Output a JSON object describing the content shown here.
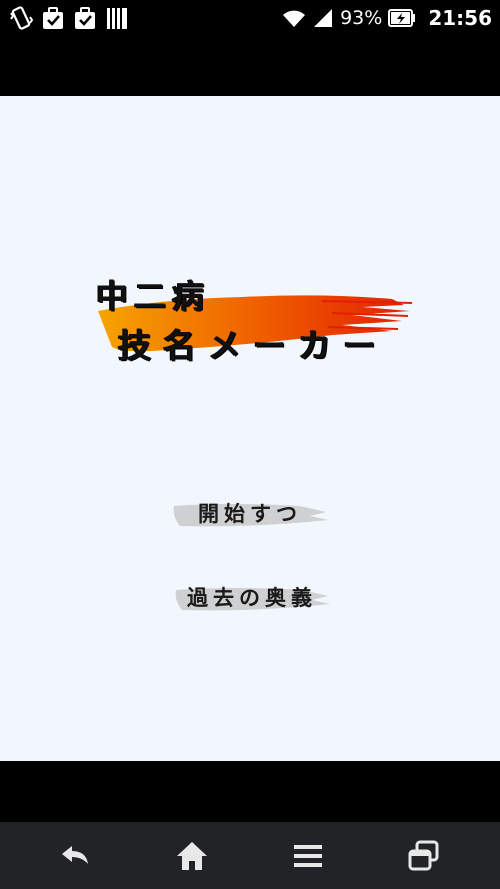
{
  "status_bar": {
    "battery_percent": "93%",
    "time": "21:56",
    "icons": [
      "vibrate-icon",
      "clipboard-check-icon",
      "briefcase-check-icon",
      "barcode-icon",
      "wifi-icon",
      "signal-icon",
      "battery-charging-icon"
    ]
  },
  "app": {
    "title_line1": "中二病",
    "title_line2": "技名メーカー",
    "brush_colors": [
      "#f7a400",
      "#e62a00"
    ]
  },
  "menu": {
    "start_label": "開始すつ",
    "past_label": "過去の奥義"
  },
  "nav_bar": {
    "icons": [
      "back-icon",
      "home-icon",
      "menu-icon",
      "recent-apps-icon"
    ]
  }
}
